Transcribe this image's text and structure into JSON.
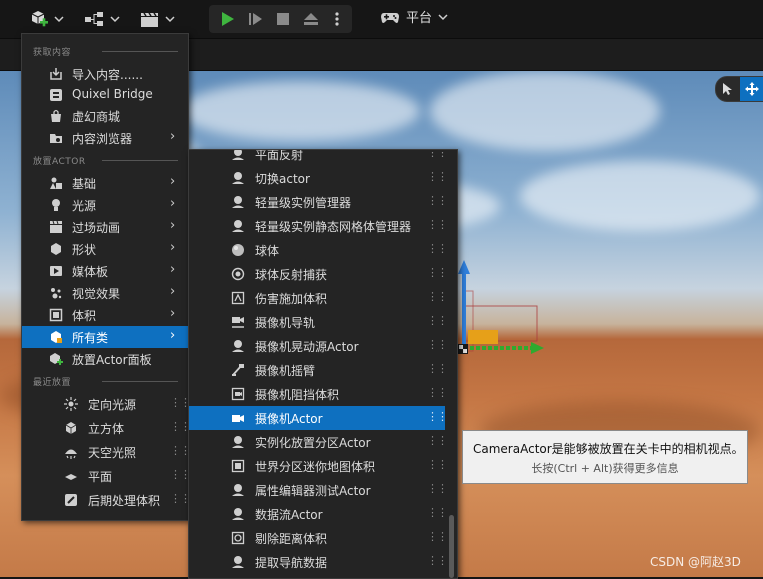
{
  "toolbar": {
    "platform_label": "平台"
  },
  "menu": {
    "section_get_content": "获取内容",
    "get_content_items": [
      {
        "label": "导入内容......",
        "icon": "import-icon"
      },
      {
        "label": "Quixel Bridge",
        "icon": "quixel-bridge-icon"
      },
      {
        "label": "虚幻商城",
        "icon": "marketplace-icon"
      },
      {
        "label": "内容浏览器",
        "icon": "content-browser-icon",
        "submenu": true
      }
    ],
    "section_place_actor": "放置ACTOR",
    "place_actor_items": [
      {
        "label": "基础",
        "icon": "basic-icon",
        "submenu": true
      },
      {
        "label": "光源",
        "icon": "light-icon",
        "submenu": true
      },
      {
        "label": "过场动画",
        "icon": "cinematic-icon",
        "submenu": true
      },
      {
        "label": "形状",
        "icon": "shape-icon",
        "submenu": true
      },
      {
        "label": "媒体板",
        "icon": "media-icon",
        "submenu": true
      },
      {
        "label": "视觉效果",
        "icon": "visual-effects-icon",
        "submenu": true
      },
      {
        "label": "体积",
        "icon": "volume-icon",
        "submenu": true
      },
      {
        "label": "所有类",
        "icon": "all-classes-icon",
        "submenu": true,
        "selected": true
      },
      {
        "label": "放置Actor面板",
        "icon": "place-actor-panel-icon"
      }
    ],
    "section_recent": "最近放置",
    "recent_items": [
      {
        "label": "定向光源",
        "icon": "directional-light-icon"
      },
      {
        "label": "立方体",
        "icon": "cube-icon"
      },
      {
        "label": "天空光照",
        "icon": "sky-light-icon"
      },
      {
        "label": "平面",
        "icon": "plane-icon"
      },
      {
        "label": "后期处理体积",
        "icon": "post-process-volume-icon"
      }
    ]
  },
  "submenu": {
    "items": [
      {
        "label": "平面反射",
        "icon": "actor-icon"
      },
      {
        "label": "切换actor",
        "icon": "actor-icon"
      },
      {
        "label": "轻量级实例管理器",
        "icon": "actor-icon"
      },
      {
        "label": "轻量级实例静态网格体管理器",
        "icon": "actor-icon"
      },
      {
        "label": "球体",
        "icon": "sphere-icon"
      },
      {
        "label": "球体反射捕获",
        "icon": "reflection-capture-icon"
      },
      {
        "label": "伤害施加体积",
        "icon": "damage-volume-icon"
      },
      {
        "label": "摄像机导轨",
        "icon": "camera-rig-rail-icon"
      },
      {
        "label": "摄像机晃动源Actor",
        "icon": "actor-icon"
      },
      {
        "label": "摄像机摇臂",
        "icon": "camera-crane-icon"
      },
      {
        "label": "摄像机阻挡体积",
        "icon": "camera-blocking-volume-icon"
      },
      {
        "label": "摄像机Actor",
        "icon": "camera-icon",
        "selected": true
      },
      {
        "label": "实例化放置分区Actor",
        "icon": "actor-icon"
      },
      {
        "label": "世界分区迷你地图体积",
        "icon": "minimap-volume-icon"
      },
      {
        "label": "属性编辑器测试Actor",
        "icon": "actor-icon"
      },
      {
        "label": "数据流Actor",
        "icon": "actor-icon"
      },
      {
        "label": "剔除距离体积",
        "icon": "cull-distance-volume-icon"
      },
      {
        "label": "提取导航数据",
        "icon": "actor-icon"
      }
    ]
  },
  "tooltip": {
    "main": "CameraActor是能够被放置在关卡中的相机视点。",
    "sub": "长按(Ctrl + Alt)获得更多信息"
  },
  "watermark": "CSDN @阿赵3D",
  "colors": {
    "accent": "#0e70c0",
    "menu_bg": "#242424",
    "play_green": "#3fb53f"
  }
}
